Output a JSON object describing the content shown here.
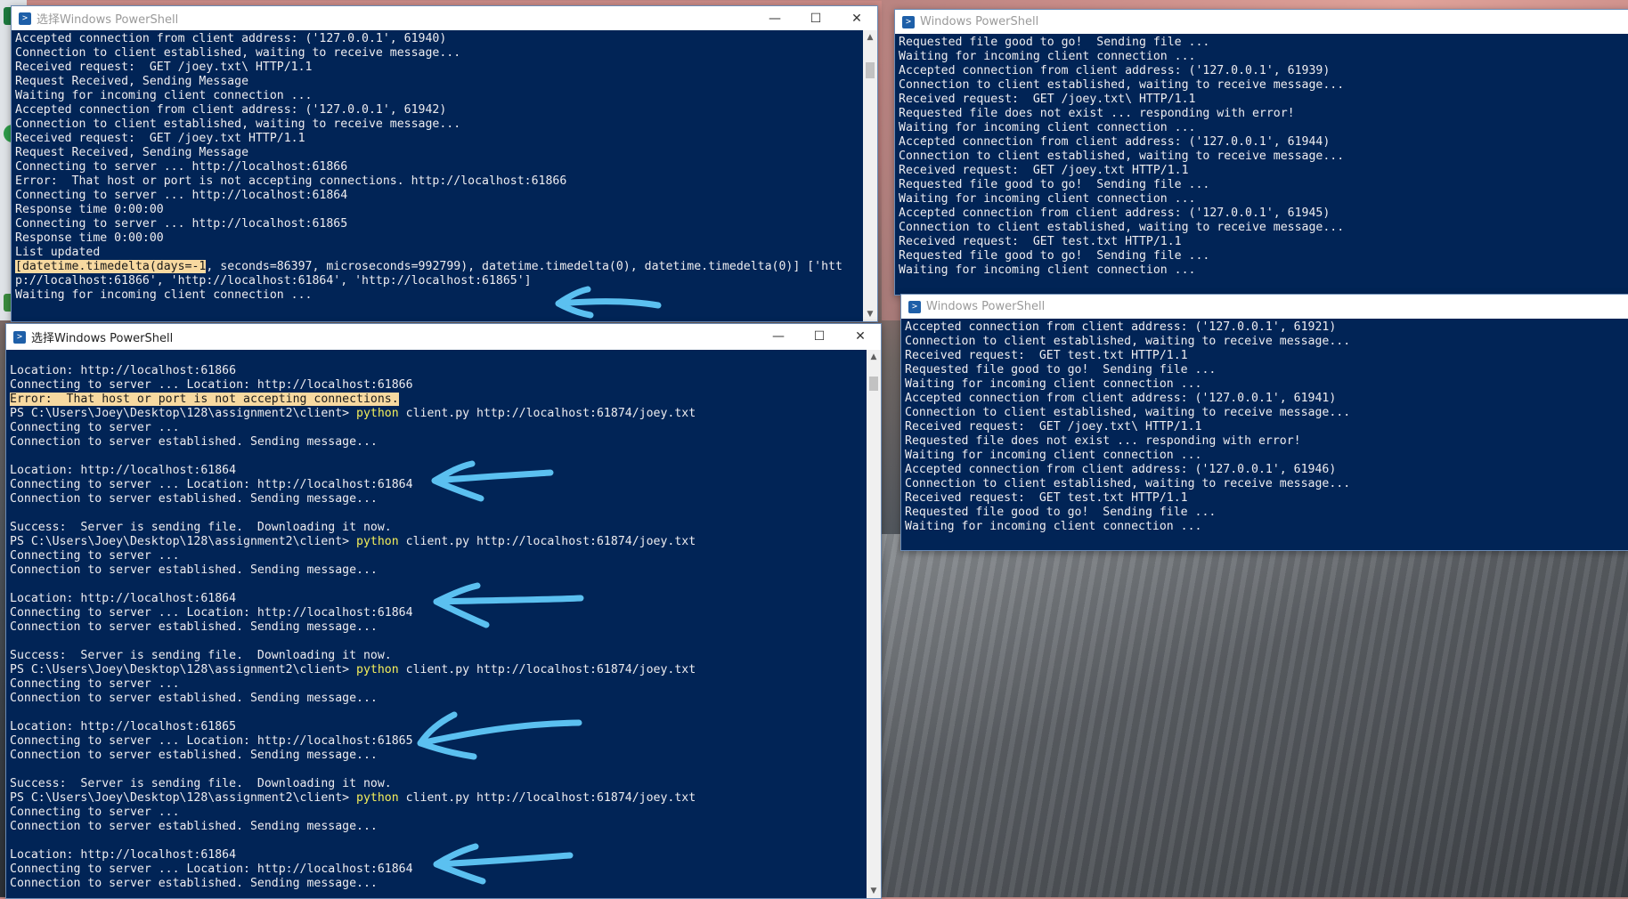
{
  "windows": {
    "top_left": {
      "title": "选择Windows PowerShell",
      "lines": [
        "Accepted connection from client address: ('127.0.0.1', 61940)",
        "Connection to client established, waiting to receive message...",
        "Received request:  GET /joey.txt\\ HTTP/1.1",
        "Request Received, Sending Message",
        "Waiting for incoming client connection ...",
        "Accepted connection from client address: ('127.0.0.1', 61942)",
        "Connection to client established, waiting to receive message...",
        "Received request:  GET /joey.txt HTTP/1.1",
        "Request Received, Sending Message",
        "Connecting to server ... http://localhost:61866",
        "Error:  That host or port is not accepting connections. http://localhost:61866",
        "Connecting to server ... http://localhost:61864",
        "Response time 0:00:00",
        "Connecting to server ... http://localhost:61865",
        "Response time 0:00:00",
        "List updated"
      ],
      "highlight_prefix": "[datetime.timedelta(days=-1",
      "highlight_rest": ", seconds=86397, microseconds=992799), datetime.timedelta(0), datetime.timedelta(0)] ['htt",
      "wrap_line": "p://localhost:61866', 'http://localhost:61864', 'http://localhost:61865']",
      "last_line": "Waiting for incoming client connection ..."
    },
    "bottom_left": {
      "title": "选择Windows PowerShell",
      "lines": [
        {
          "t": ""
        },
        {
          "t": "Location: http://localhost:61866"
        },
        {
          "t": "Connecting to server ... Location: http://localhost:61866"
        },
        {
          "t": "Error:  That host or port is not accepting connections.",
          "hl": true
        },
        {
          "prompt": "PS C:\\Users\\Joey\\Desktop\\128\\assignment2\\client> ",
          "cmd": "python",
          "args": " client.py http://localhost:61874/joey.txt"
        },
        {
          "t": "Connecting to server ..."
        },
        {
          "t": "Connection to server established. Sending message..."
        },
        {
          "t": ""
        },
        {
          "t": "Location: http://localhost:61864"
        },
        {
          "t": "Connecting to server ... Location: http://localhost:61864"
        },
        {
          "t": "Connection to server established. Sending message..."
        },
        {
          "t": ""
        },
        {
          "t": "Success:  Server is sending file.  Downloading it now."
        },
        {
          "prompt": "PS C:\\Users\\Joey\\Desktop\\128\\assignment2\\client> ",
          "cmd": "python",
          "args": " client.py http://localhost:61874/joey.txt"
        },
        {
          "t": "Connecting to server ..."
        },
        {
          "t": "Connection to server established. Sending message..."
        },
        {
          "t": ""
        },
        {
          "t": "Location: http://localhost:61864"
        },
        {
          "t": "Connecting to server ... Location: http://localhost:61864"
        },
        {
          "t": "Connection to server established. Sending message..."
        },
        {
          "t": ""
        },
        {
          "t": "Success:  Server is sending file.  Downloading it now."
        },
        {
          "prompt": "PS C:\\Users\\Joey\\Desktop\\128\\assignment2\\client> ",
          "cmd": "python",
          "args": " client.py http://localhost:61874/joey.txt"
        },
        {
          "t": "Connecting to server ..."
        },
        {
          "t": "Connection to server established. Sending message..."
        },
        {
          "t": ""
        },
        {
          "t": "Location: http://localhost:61865"
        },
        {
          "t": "Connecting to server ... Location: http://localhost:61865"
        },
        {
          "t": "Connection to server established. Sending message..."
        },
        {
          "t": ""
        },
        {
          "t": "Success:  Server is sending file.  Downloading it now."
        },
        {
          "prompt": "PS C:\\Users\\Joey\\Desktop\\128\\assignment2\\client> ",
          "cmd": "python",
          "args": " client.py http://localhost:61874/joey.txt"
        },
        {
          "t": "Connecting to server ..."
        },
        {
          "t": "Connection to server established. Sending message..."
        },
        {
          "t": ""
        },
        {
          "t": "Location: http://localhost:61864"
        },
        {
          "t": "Connecting to server ... Location: http://localhost:61864"
        },
        {
          "t": "Connection to server established. Sending message..."
        }
      ]
    },
    "top_right": {
      "title": "Windows PowerShell",
      "lines": [
        "Requested file good to go!  Sending file ...",
        "Waiting for incoming client connection ...",
        "Accepted connection from client address: ('127.0.0.1', 61939)",
        "Connection to client established, waiting to receive message...",
        "Received request:  GET /joey.txt\\ HTTP/1.1",
        "Requested file does not exist ... responding with error!",
        "Waiting for incoming client connection ...",
        "Accepted connection from client address: ('127.0.0.1', 61944)",
        "Connection to client established, waiting to receive message...",
        "Received request:  GET /joey.txt HTTP/1.1",
        "Requested file good to go!  Sending file ...",
        "Waiting for incoming client connection ...",
        "Accepted connection from client address: ('127.0.0.1', 61945)",
        "Connection to client established, waiting to receive message...",
        "Received request:  GET test.txt HTTP/1.1",
        "Requested file good to go!  Sending file ...",
        "Waiting for incoming client connection ..."
      ]
    },
    "bottom_right": {
      "title": "Windows PowerShell",
      "lines": [
        "Accepted connection from client address: ('127.0.0.1', 61921)",
        "Connection to client established, waiting to receive message...",
        "Received request:  GET test.txt HTTP/1.1",
        "Requested file good to go!  Sending file ...",
        "Waiting for incoming client connection ...",
        "Accepted connection from client address: ('127.0.0.1', 61941)",
        "Connection to client established, waiting to receive message...",
        "Received request:  GET /joey.txt\\ HTTP/1.1",
        "Requested file does not exist ... responding with error!",
        "Waiting for incoming client connection ...",
        "Accepted connection from client address: ('127.0.0.1', 61946)",
        "Connection to client established, waiting to receive message...",
        "Received request:  GET test.txt HTTP/1.1",
        "Requested file good to go!  Sending file ...",
        "Waiting for incoming client connection ..."
      ]
    }
  },
  "controls": {
    "minimize": "—",
    "maximize": "☐",
    "close": "✕"
  },
  "icons": {
    "powershell": "powershell-icon",
    "arrow": "arrow-annotation"
  },
  "colors": {
    "console_bg": "#012456",
    "console_fg": "#eeedf0",
    "command": "#f4ef5b",
    "highlight": "#f7d9a0",
    "arrow": "#5bc0f0"
  }
}
